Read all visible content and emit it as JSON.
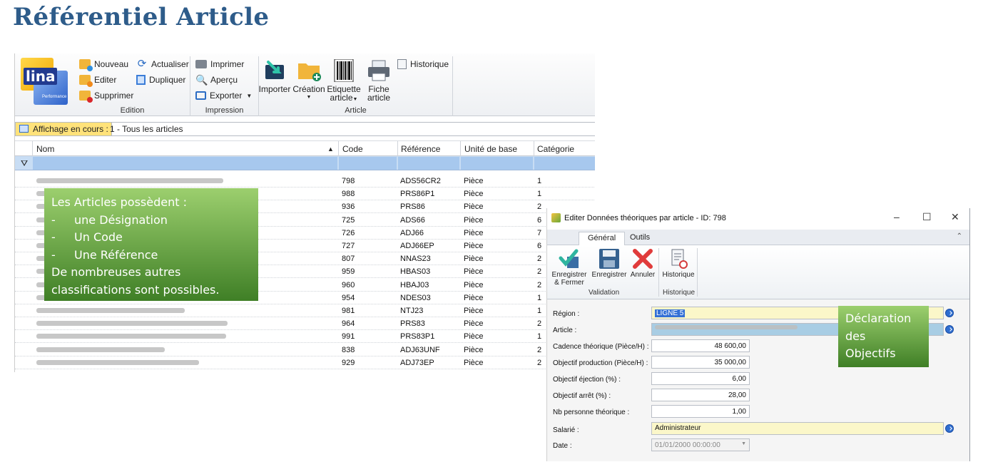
{
  "page": {
    "title": "Référentiel Article"
  },
  "app": {
    "logo": {
      "text": "lina",
      "sub": "Performance"
    },
    "ribbon": {
      "edition": {
        "label": "Edition",
        "nouveau": "Nouveau",
        "editer": "Editer",
        "supprimer": "Supprimer",
        "actualiser": "Actualiser",
        "dupliquer": "Dupliquer"
      },
      "impression": {
        "label": "Impression",
        "imprimer": "Imprimer",
        "apercu": "Aperçu",
        "exporter": "Exporter"
      },
      "article": {
        "label": "Article",
        "importer": "Importer",
        "creation": "Création",
        "etiquette_1": "Etiquette",
        "etiquette_2": "article",
        "fiche_1": "Fiche",
        "fiche_2": "article",
        "historique": "Historique"
      }
    },
    "view_bar": {
      "label": "Affichage en cours :",
      "value": "1 - Tous les articles"
    },
    "grid": {
      "columns": [
        "Nom",
        "Code",
        "Référence",
        "Unité de base",
        "Catégorie"
      ],
      "rows": [
        {
          "code": "798",
          "ref": "ADS56CR2",
          "unit": "Pièce",
          "cat": "1"
        },
        {
          "code": "988",
          "ref": "PRS86P1",
          "unit": "Pièce",
          "cat": "1"
        },
        {
          "code": "936",
          "ref": "PRS86",
          "unit": "Pièce",
          "cat": "2"
        },
        {
          "code": "725",
          "ref": "ADS66",
          "unit": "Pièce",
          "cat": "6"
        },
        {
          "code": "726",
          "ref": "ADJ66",
          "unit": "Pièce",
          "cat": "7"
        },
        {
          "code": "727",
          "ref": "ADJ66EP",
          "unit": "Pièce",
          "cat": "6"
        },
        {
          "code": "807",
          "ref": "NNAS23",
          "unit": "Pièce",
          "cat": "2"
        },
        {
          "code": "959",
          "ref": "HBAS03",
          "unit": "Pièce",
          "cat": "2"
        },
        {
          "code": "960",
          "ref": "HBAJ03",
          "unit": "Pièce",
          "cat": "2"
        },
        {
          "code": "954",
          "ref": "NDES03",
          "unit": "Pièce",
          "cat": "1"
        },
        {
          "code": "981",
          "ref": "NTJ23",
          "unit": "Pièce",
          "cat": "1"
        },
        {
          "code": "964",
          "ref": "PRS83",
          "unit": "Pièce",
          "cat": "2"
        },
        {
          "code": "991",
          "ref": "PRS83P1",
          "unit": "Pièce",
          "cat": "1"
        },
        {
          "code": "838",
          "ref": "ADJ63UNF",
          "unit": "Pièce",
          "cat": "2"
        },
        {
          "code": "929",
          "ref": "ADJ73EP",
          "unit": "Pièce",
          "cat": "2"
        }
      ]
    },
    "callout": {
      "intro": "Les Articles possèdent :",
      "item1": "une Désignation",
      "item2": "Un Code",
      "item3": "Une Référence",
      "outro1": "De nombreuses autres",
      "outro2": "classifications sont possibles.",
      "dash": "-"
    }
  },
  "dialog": {
    "title": "Editer Données théoriques par article - ID: 798",
    "controls": {
      "minimize": "–",
      "maximize": "☐",
      "close": "✕"
    },
    "tabs": {
      "general": "Général",
      "outils": "Outils"
    },
    "buttons": {
      "save_close_1": "Enregistrer",
      "save_close_2": "& Fermer",
      "save": "Enregistrer",
      "cancel": "Annuler",
      "history": "Historique"
    },
    "groups": {
      "validation": "Validation",
      "historique": "Historique"
    },
    "fields": {
      "region_label": "Région :",
      "region_value": "LIGNE 5",
      "article_label": "Article :",
      "cadence_label": "Cadence théorique (Pièce/H) :",
      "cadence_value": "48 600,00",
      "objectif_label": "Objectif production (Pièce/H) :",
      "objectif_value": "35 000,00",
      "ejection_label": "Objectif éjection (%) :",
      "ejection_value": "6,00",
      "arret_label": "Objectif arrêt (%) :",
      "arret_value": "28,00",
      "nb_label": "Nb personne théorique :",
      "nb_value": "1,00",
      "salarie_label": "Salarié :",
      "salarie_value": "Administrateur",
      "date_label": "Date :",
      "date_value": "01/01/2000 00:00:00"
    },
    "callout": {
      "line1": "Déclaration",
      "line2": "des",
      "line3": "Objectifs"
    }
  }
}
